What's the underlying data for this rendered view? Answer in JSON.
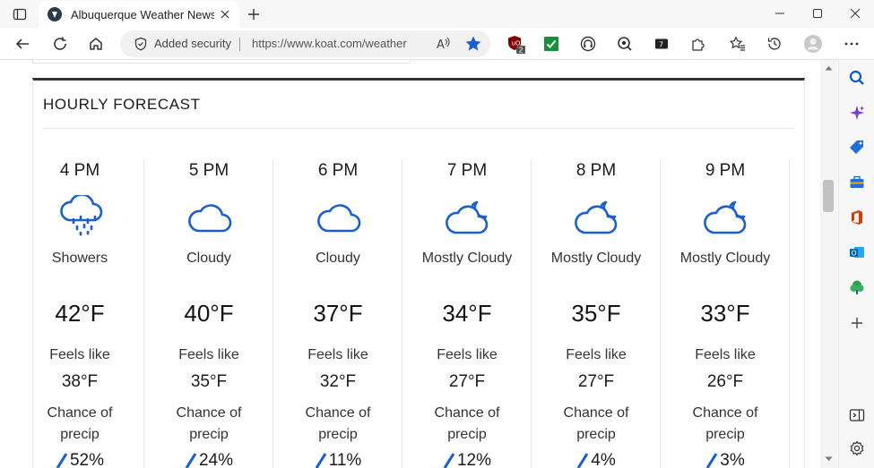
{
  "browser": {
    "tab_title": "Albuquerque Weather News – N",
    "security_label": "Added security",
    "url": "https://www.koat.com/weather",
    "extension_badge": "2"
  },
  "page": {
    "section_title": "HOURLY FORECAST"
  },
  "forecast": [
    {
      "time": "4 PM",
      "condition": "Showers",
      "icon": "showers-icon",
      "temp": "42°F",
      "feels_label": "Feels like",
      "feels": "38°F",
      "chance_label_1": "Chance of",
      "chance_label_2": "precip",
      "precip": "52%"
    },
    {
      "time": "5 PM",
      "condition": "Cloudy",
      "icon": "cloudy-icon",
      "temp": "40°F",
      "feels_label": "Feels like",
      "feels": "35°F",
      "chance_label_1": "Chance of",
      "chance_label_2": "precip",
      "precip": "24%"
    },
    {
      "time": "6 PM",
      "condition": "Cloudy",
      "icon": "cloudy-icon",
      "temp": "37°F",
      "feels_label": "Feels like",
      "feels": "32°F",
      "chance_label_1": "Chance of",
      "chance_label_2": "precip",
      "precip": "11%"
    },
    {
      "time": "7 PM",
      "condition": "Mostly Cloudy",
      "icon": "mostly-cloudy-night-icon",
      "temp": "34°F",
      "feels_label": "Feels like",
      "feels": "27°F",
      "chance_label_1": "Chance of",
      "chance_label_2": "precip",
      "precip": "12%"
    },
    {
      "time": "8 PM",
      "condition": "Mostly Cloudy",
      "icon": "mostly-cloudy-night-icon",
      "temp": "35°F",
      "feels_label": "Feels like",
      "feels": "27°F",
      "chance_label_1": "Chance of",
      "chance_label_2": "precip",
      "precip": "4%"
    },
    {
      "time": "9 PM",
      "condition": "Mostly Cloudy",
      "icon": "mostly-cloudy-night-icon",
      "temp": "33°F",
      "feels_label": "Feels like",
      "feels": "26°F",
      "chance_label_1": "Chance of",
      "chance_label_2": "precip",
      "precip": "3%"
    }
  ],
  "colors": {
    "icon_blue": "#1a5fd1",
    "card_border": "#333333",
    "edge_blue": "#0c59d6"
  }
}
